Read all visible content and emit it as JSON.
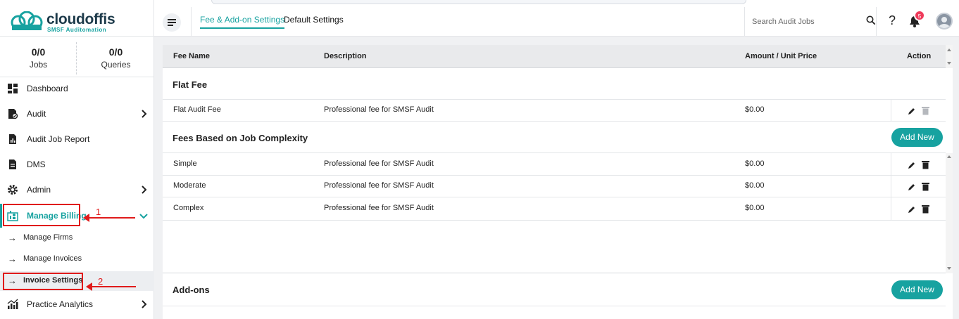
{
  "app": {
    "brand": "cloudoffis",
    "tagline": "SMSF Auditomation"
  },
  "stats": {
    "jobs": {
      "value": "0/0",
      "label": "Jobs"
    },
    "queries": {
      "value": "0/0",
      "label": "Queries"
    }
  },
  "sidebar": {
    "items": [
      {
        "label": "Dashboard",
        "icon": "dashboard-icon"
      },
      {
        "label": "Audit",
        "icon": "audit-icon"
      },
      {
        "label": "Audit Job Report",
        "icon": "report-icon"
      },
      {
        "label": "DMS",
        "icon": "document-icon"
      },
      {
        "label": "Admin",
        "icon": "admin-gear-icon"
      },
      {
        "label": "Manage Billing",
        "icon": "billing-icon"
      },
      {
        "label": "Practice Analytics",
        "icon": "analytics-icon"
      }
    ],
    "billing_subitems": [
      {
        "label": "Manage Firms"
      },
      {
        "label": "Manage Invoices"
      },
      {
        "label": "Invoice Settings"
      }
    ]
  },
  "annotations": {
    "marker_1": "1",
    "marker_2": "2",
    "color": "#e01b1b"
  },
  "header": {
    "tabs": [
      {
        "label": "Fee & Add-on Settings",
        "active": true
      },
      {
        "label": "Default Settings",
        "active": false
      }
    ],
    "search_placeholder": "Search Audit Jobs",
    "help_label": "?",
    "notification_count": "5"
  },
  "table": {
    "columns": {
      "fee_name": "Fee Name",
      "description": "Description",
      "amount": "Amount / Unit Price",
      "action": "Action"
    },
    "flat_fee": {
      "title": "Flat Fee",
      "rows": [
        {
          "name": "Flat Audit Fee",
          "description": "Professional fee for SMSF Audit",
          "amount": "$0.00"
        }
      ]
    },
    "complexity": {
      "title": "Fees Based on Job Complexity",
      "add_label": "Add New",
      "rows": [
        {
          "name": "Simple",
          "description": "Professional fee for SMSF Audit",
          "amount": "$0.00"
        },
        {
          "name": "Moderate",
          "description": "Professional fee for SMSF Audit",
          "amount": "$0.00"
        },
        {
          "name": "Complex",
          "description": "Professional fee for SMSF Audit",
          "amount": "$0.00"
        }
      ]
    },
    "addons": {
      "title": "Add-ons",
      "add_label": "Add New"
    }
  },
  "colors": {
    "accent": "#17a2a0",
    "badge": "#ef3b5b",
    "brand_dark": "#1d3a4a"
  }
}
